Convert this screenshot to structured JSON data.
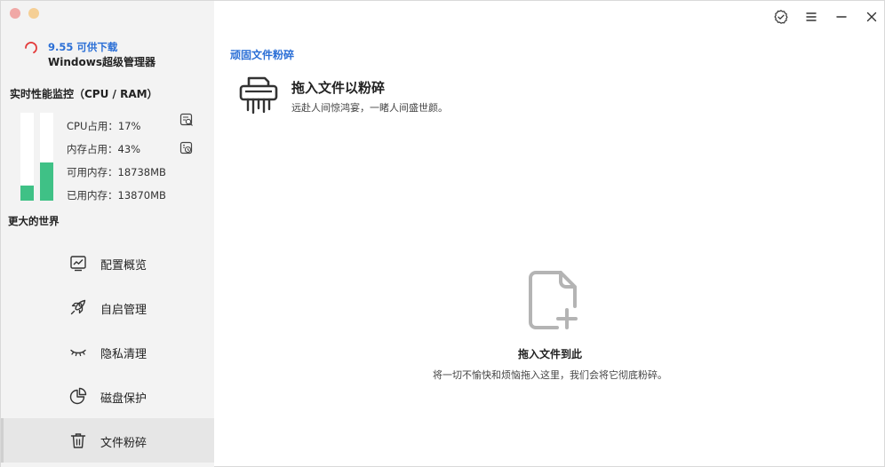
{
  "window": {
    "controls": [
      "close",
      "minimize"
    ],
    "titlebar_icons": [
      "verified-icon",
      "menu-icon",
      "minimize-icon",
      "close-icon"
    ]
  },
  "app": {
    "version_label": "9.55 可供下载",
    "name": "Windows超级管理器"
  },
  "monitor": {
    "title": "实时性能监控（CPU / RAM）",
    "cpu_label": "CPU占用：17%",
    "ram_label": "内存占用：43%",
    "avail_label": "可用内存：18738MB",
    "used_label": "已用内存：13870MB",
    "cpu_percent": 17,
    "ram_percent": 43,
    "bar_color": "#3fc186"
  },
  "slogan": "更大的世界",
  "nav": {
    "items": [
      {
        "label": "配置概览",
        "icon": "chart-icon"
      },
      {
        "label": "自启管理",
        "icon": "rocket-icon"
      },
      {
        "label": "隐私清理",
        "icon": "eye-closed-icon"
      },
      {
        "label": "磁盘保护",
        "icon": "pie-icon"
      },
      {
        "label": "文件粉碎",
        "icon": "trash-icon",
        "active": true
      }
    ]
  },
  "main": {
    "section_title": "顽固文件粉碎",
    "header_title": "拖入文件以粉碎",
    "header_desc": "远赴人间惊鸿宴，一睹人间盛世颜。",
    "drop_title": "拖入文件到此",
    "drop_desc": "将一切不愉快和烦恼拖入这里，我们会将它彻底粉碎。"
  },
  "colors": {
    "accent": "#2b6fd6",
    "sidebar_bg": "#f3f3f3",
    "active_nav_bg": "#e6e6e6"
  }
}
